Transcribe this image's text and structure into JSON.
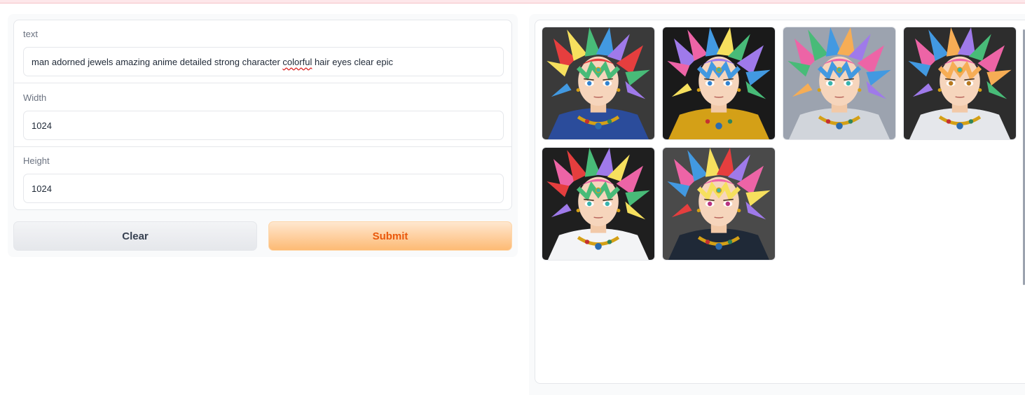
{
  "form": {
    "text": {
      "label": "text",
      "value_before": "man adorned jewels amazing anime detailed strong character ",
      "value_misspelled": "colorful",
      "value_after": " hair eyes clear epic"
    },
    "width": {
      "label": "Width",
      "value": "1024"
    },
    "height": {
      "label": "Height",
      "value": "1024"
    }
  },
  "buttons": {
    "clear": "Clear",
    "submit": "Submit"
  },
  "colors": {
    "accent": "#ea580c",
    "submit_bg": "#fdba74",
    "border": "#e5e7eb"
  },
  "gallery": {
    "images": [
      {
        "name": "generated-image-1",
        "bg": "#3a3a3a",
        "hair": [
          "#e53e3e",
          "#f6e05e",
          "#48bb78",
          "#4299e1",
          "#9f7aea"
        ],
        "eye": "#3182ce",
        "outfit": "#2b4c9b"
      },
      {
        "name": "generated-image-2",
        "bg": "#1a1a1a",
        "hair": [
          "#9f7aea",
          "#ed64a6",
          "#4299e1",
          "#f6e05e",
          "#48bb78"
        ],
        "eye": "#3182ce",
        "outfit": "#d4a017"
      },
      {
        "name": "generated-image-3",
        "bg": "#9ca3af",
        "hair": [
          "#ed64a6",
          "#48bb78",
          "#4299e1",
          "#f6ad55",
          "#9f7aea"
        ],
        "eye": "#38b2ac",
        "outfit": "#d1d5db"
      },
      {
        "name": "generated-image-4",
        "bg": "#2d2d2d",
        "hair": [
          "#ed64a6",
          "#4299e1",
          "#f6ad55",
          "#9f7aea",
          "#48bb78"
        ],
        "eye": "#b7791f",
        "outfit": "#e5e7eb"
      },
      {
        "name": "generated-image-5",
        "bg": "#1f1f1f",
        "hair": [
          "#ed64a6",
          "#e53e3e",
          "#48bb78",
          "#9f7aea",
          "#f6e05e"
        ],
        "eye": "#38b2ac",
        "outfit": "#f3f4f6"
      },
      {
        "name": "generated-image-6",
        "bg": "#4a4a4a",
        "hair": [
          "#ed64a6",
          "#4299e1",
          "#f6e05e",
          "#e53e3e",
          "#9f7aea"
        ],
        "eye": "#b83280",
        "outfit": "#1f2937"
      }
    ]
  }
}
